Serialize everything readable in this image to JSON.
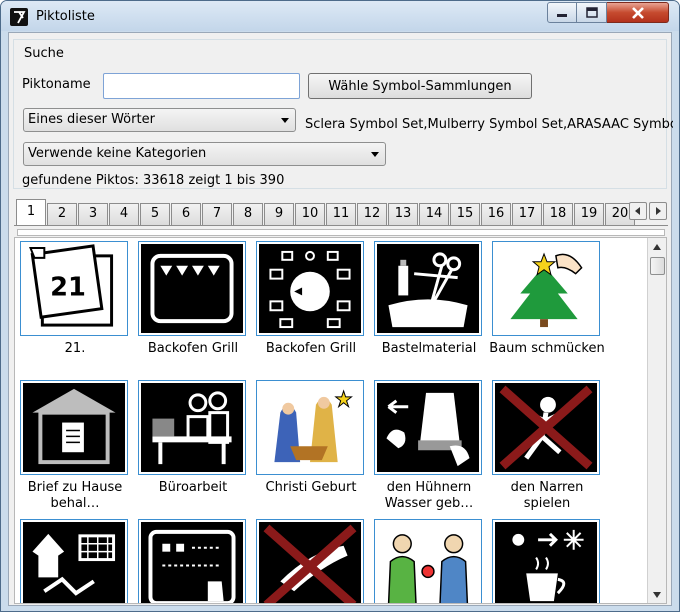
{
  "window": {
    "title": "Piktoliste"
  },
  "search": {
    "group_label": "Suche",
    "name_label": "Piktoname",
    "name_value": "",
    "collections_button": "Wähle Symbol-Sammlungen",
    "word_mode": "Eines dieser Wörter",
    "collections_text": "Sclera Symbol Set,Mulberry Symbol Set,ARASAAC Symbo",
    "category_mode": "Verwende keine Kategorien",
    "result_text": "gefundene Piktos: 33618 zeigt 1 bis 390"
  },
  "tabs": [
    "1",
    "2",
    "3",
    "4",
    "5",
    "6",
    "7",
    "8",
    "9",
    "10",
    "11",
    "12",
    "13",
    "14",
    "15",
    "16",
    "17",
    "18",
    "19",
    "20"
  ],
  "selected_tab": "1",
  "pictograms": [
    {
      "caption": "21.",
      "icon": "calendar-21-icon"
    },
    {
      "caption": "Backofen Grill",
      "icon": "oven-grill-icon"
    },
    {
      "caption": "Backofen Grill",
      "icon": "oven-dial-icon"
    },
    {
      "caption": "Bastelmaterial",
      "icon": "craft-supplies-icon"
    },
    {
      "caption": "Baum schmücken",
      "icon": "christmas-tree-icon"
    },
    {
      "caption": "Brief zu Hause behal…",
      "icon": "letter-at-home-icon"
    },
    {
      "caption": "Büroarbeit",
      "icon": "office-work-icon"
    },
    {
      "caption": "Christi Geburt",
      "icon": "nativity-icon"
    },
    {
      "caption": "den Hühnern Wasser geb…",
      "icon": "water-chickens-icon"
    },
    {
      "caption": "den Narren spielen",
      "icon": "fool-crossed-icon"
    },
    {
      "caption": "",
      "icon": "laundry-icon"
    },
    {
      "caption": "",
      "icon": "board-pointer-icon"
    },
    {
      "caption": "",
      "icon": "hand-crossed-icon"
    },
    {
      "caption": "",
      "icon": "give-gift-icon"
    },
    {
      "caption": "",
      "icon": "hot-drink-icon"
    }
  ],
  "colors": {
    "tile_border": "#3b8fd1",
    "title_bar": "#cbdcec",
    "close_button": "#c64b2f",
    "cross_red": "#8b1a1a"
  }
}
